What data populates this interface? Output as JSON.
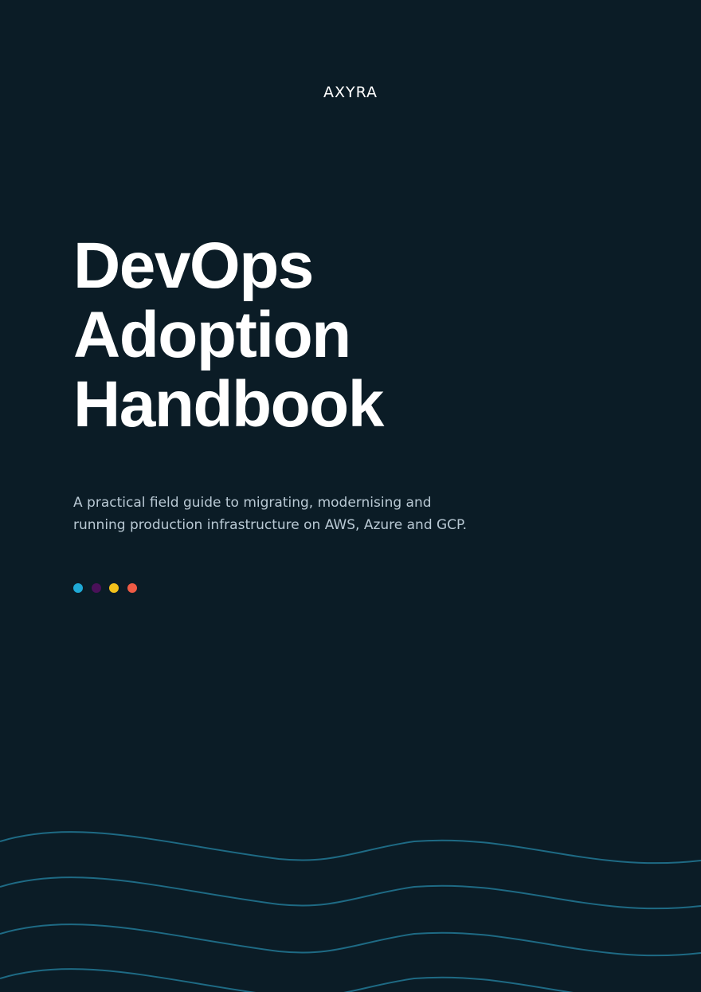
{
  "brand": {
    "logo_text": "AXYRA"
  },
  "cover": {
    "title_lines": [
      "DevOps",
      "Adoption",
      "Handbook"
    ],
    "subtitle_lines": [
      "A practical field guide to migrating, modernising and",
      "running production infrastructure on AWS, Azure and GCP."
    ]
  },
  "colors": {
    "background": "#0b1c26",
    "title": "#ffffff",
    "subtitle": "#b9c9d4",
    "wave_stroke": "#1e6a84",
    "dots": [
      "#1fa9d6",
      "#4a1159",
      "#f4c21b",
      "#ef5b45"
    ]
  }
}
